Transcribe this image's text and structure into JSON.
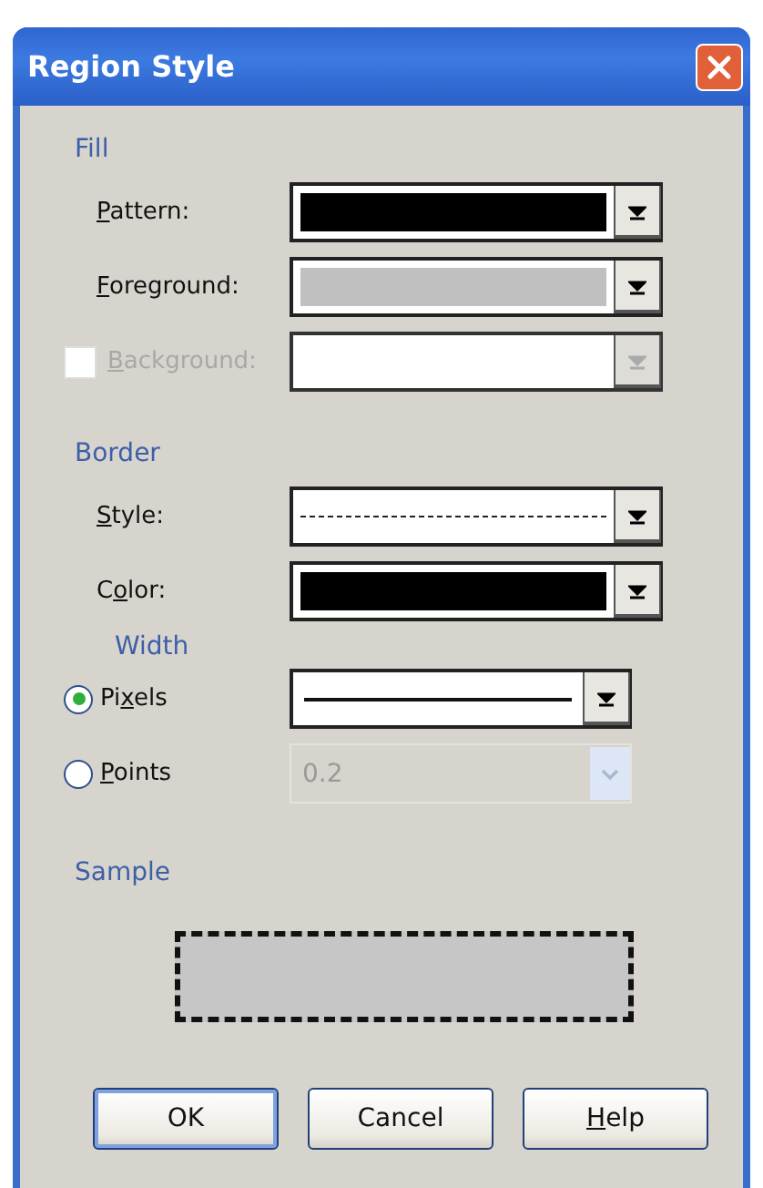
{
  "window": {
    "title": "Region Style"
  },
  "fill": {
    "heading": "Fill",
    "rows": [
      {
        "label": {
          "key": "P",
          "post": "attern:"
        },
        "kind": "swatch",
        "color": "#000000",
        "disabled": false
      },
      {
        "label": {
          "key": "F",
          "post": "oreground:"
        },
        "kind": "swatch",
        "color": "#c0c0c0",
        "disabled": false
      },
      {
        "label": {
          "key": "B",
          "post": "ackground:"
        },
        "kind": "empty",
        "disabled": true,
        "checked": false
      }
    ]
  },
  "border": {
    "heading": "Border",
    "rows": [
      {
        "label": {
          "key": "S",
          "post": "tyle:"
        },
        "kind": "dashed",
        "disabled": false
      },
      {
        "label": {
          "pre": "C",
          "key": "o",
          "post": "lor:"
        },
        "kind": "swatch",
        "color": "#000000",
        "disabled": false
      }
    ],
    "width": {
      "heading": "Width",
      "options": [
        {
          "label": {
            "pre": "Pi",
            "key": "x",
            "post": "els"
          },
          "selected": true,
          "kind": "line"
        },
        {
          "label": {
            "key": "P",
            "post": "oints"
          },
          "selected": false,
          "kind": "text",
          "value": "0.2"
        }
      ]
    }
  },
  "sample": {
    "heading": "Sample"
  },
  "buttons": [
    {
      "label": {
        "pre": "OK"
      },
      "default": true
    },
    {
      "label": {
        "pre": "Cancel"
      },
      "default": false
    },
    {
      "label": {
        "key": "H",
        "post": "elp"
      },
      "default": false
    }
  ]
}
